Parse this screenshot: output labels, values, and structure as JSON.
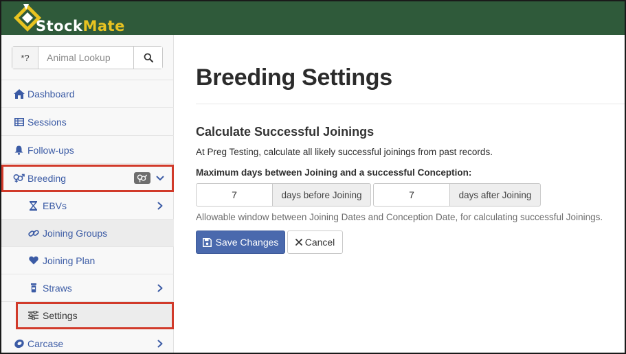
{
  "app": {
    "brand_part1": "Stock",
    "brand_part2": "Mate",
    "colors": {
      "header": "#2f5a3a",
      "brand_accent": "#e8c321",
      "link": "#3b5ba5",
      "primary_button": "#4a69ad",
      "highlight_outline": "#d13a2a"
    }
  },
  "search": {
    "wildcard_label": "*?",
    "placeholder": "Animal Lookup",
    "icon": "search-icon"
  },
  "sidebar": {
    "items": [
      {
        "label": "Dashboard",
        "icon": "home-icon"
      },
      {
        "label": "Sessions",
        "icon": "table-icon"
      },
      {
        "label": "Follow-ups",
        "icon": "bell-icon"
      },
      {
        "label": "Breeding",
        "icon": "gender-icon",
        "badge_icon": "gender-icon",
        "expanded": true,
        "highlighted": true
      },
      {
        "label": "EBVs",
        "icon": "hourglass-icon",
        "has_submenu": true
      },
      {
        "label": "Joining Groups",
        "icon": "link-icon"
      },
      {
        "label": "Joining Plan",
        "icon": "heart-icon"
      },
      {
        "label": "Straws",
        "icon": "vial-icon",
        "has_submenu": true
      },
      {
        "label": "Settings",
        "icon": "sliders-icon",
        "active": true,
        "highlighted": true
      },
      {
        "label": "Carcase",
        "icon": "steak-icon",
        "has_submenu": true
      }
    ]
  },
  "main": {
    "title": "Breeding Settings",
    "section_title": "Calculate Successful Joinings",
    "description": "At Preg Testing, calculate all likely successful joinings from past records.",
    "field_label": "Maximum days between Joining and a successful Conception:",
    "before": {
      "value": "7",
      "addon": "days before Joining"
    },
    "after": {
      "value": "7",
      "addon": "days after Joining"
    },
    "help_text": "Allowable window between Joining Dates and Conception Date, for calculating successful Joinings.",
    "save_label": "Save Changes",
    "cancel_label": "Cancel"
  }
}
